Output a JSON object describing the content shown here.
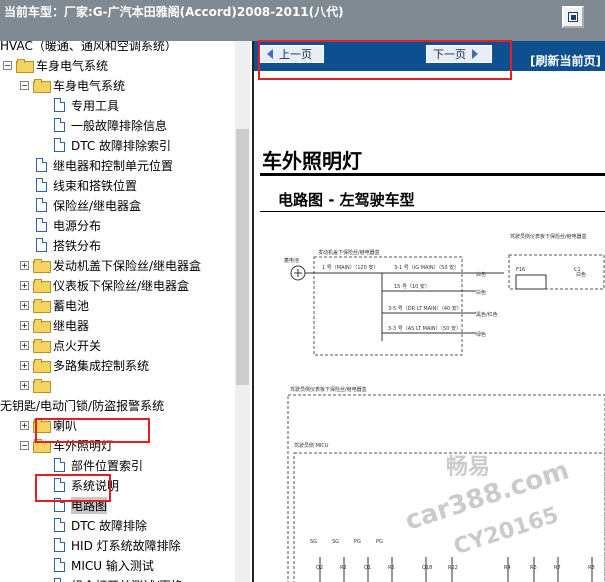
{
  "window": {
    "title": "当前车型：厂家:G-广汽本田雅阁(Accord)2008-2011(八代)"
  },
  "tree": {
    "rows": [
      {
        "label": "HVAC（暖通、通风和空调系统）",
        "level": 0,
        "kind": "none"
      },
      {
        "label": "车身电气系统",
        "level": 0,
        "kind": "folder-open"
      },
      {
        "label": "车身电气系统",
        "level": 1,
        "kind": "folder-open"
      },
      {
        "label": "专用工具",
        "level": 2,
        "kind": "doc"
      },
      {
        "label": "一般故障排除信息",
        "level": 2,
        "kind": "doc"
      },
      {
        "label": "DTC 故障排除索引",
        "level": 2,
        "kind": "doc"
      },
      {
        "label": "继电器和控制单元位置",
        "level": 1,
        "kind": "doc"
      },
      {
        "label": "线束和搭铁位置",
        "level": 1,
        "kind": "doc"
      },
      {
        "label": "保险丝/继电器盒",
        "level": 1,
        "kind": "doc"
      },
      {
        "label": "电源分布",
        "level": 1,
        "kind": "doc"
      },
      {
        "label": "搭铁分布",
        "level": 1,
        "kind": "doc"
      },
      {
        "label": "发动机盖下保险丝/继电器盒",
        "level": 1,
        "kind": "folder"
      },
      {
        "label": "仪表板下保险丝/继电器盒",
        "level": 1,
        "kind": "folder"
      },
      {
        "label": "蓄电池",
        "level": 1,
        "kind": "folder"
      },
      {
        "label": "继电器",
        "level": 1,
        "kind": "folder"
      },
      {
        "label": "点火开关",
        "level": 1,
        "kind": "folder"
      },
      {
        "label": "多路集成控制系统",
        "level": 1,
        "kind": "folder"
      },
      {
        "label": "",
        "level": 1,
        "kind": "folder"
      },
      {
        "label": "无钥匙/电动门锁/防盗报警系统",
        "level": 0,
        "kind": "none"
      },
      {
        "label": "喇叭",
        "level": 1,
        "kind": "folder"
      },
      {
        "label": "车外照明灯",
        "level": 1,
        "kind": "folder-open"
      },
      {
        "label": "部件位置索引",
        "level": 2,
        "kind": "doc"
      },
      {
        "label": "系统说明",
        "level": 2,
        "kind": "doc"
      },
      {
        "label": "电路图",
        "level": 2,
        "kind": "doc",
        "selected": true
      },
      {
        "label": "DTC 故障排除",
        "level": 2,
        "kind": "doc"
      },
      {
        "label": "HID 灯系统故障排除",
        "level": 2,
        "kind": "doc"
      },
      {
        "label": "MICU 输入测试",
        "level": 2,
        "kind": "doc"
      },
      {
        "label": "组合灯开关测试/更换",
        "level": 2,
        "kind": "doc"
      }
    ]
  },
  "nav": {
    "prev_label": "上一页",
    "next_label": "下一页",
    "refresh_label": "[刷新当前页]"
  },
  "doc": {
    "title": "车外照明灯",
    "subtitle": "电路图 - 左驾驶车型",
    "diagram": {
      "box1_label": "发动机盖下保险丝/继电器盒",
      "battery_label": "蓄电池",
      "fuse1": "1 号（MAIN）（120 安）",
      "fuse2": "3-1 号（IG MAIN）（50 安）",
      "fuse3": "15 号（10 安）",
      "fuse4": "3-5 号（DR LT MAIN）（40 安）",
      "fuse5": "3-3 号（AS LT MAIN）（50 安）",
      "box2_label": "驾驶员侧仪表板下保险丝/继电器盒",
      "f16": "F16",
      "c1": "C1",
      "wire_white": "白色",
      "wire_black_red": "黑色/红色",
      "wire_green": "绿色",
      "box3_label": "驾驶员侧仪表板下保险丝/继电器盒",
      "micu_label": "驾驶员侧 MICU",
      "connectors": [
        "SG",
        "SG",
        "PG",
        "PG"
      ],
      "pins": [
        "Q2",
        "R2",
        "Q1",
        "R5",
        "Q18",
        "R22",
        "R4",
        "R6",
        "R7",
        "R8"
      ]
    }
  },
  "watermark": {
    "line1": "畅易",
    "line2": "car388.com",
    "line3": "CY20165"
  },
  "colors": {
    "titlebar": "#7f8a93",
    "navbar": "#0d4f8f",
    "highlight": "#e31e24"
  }
}
